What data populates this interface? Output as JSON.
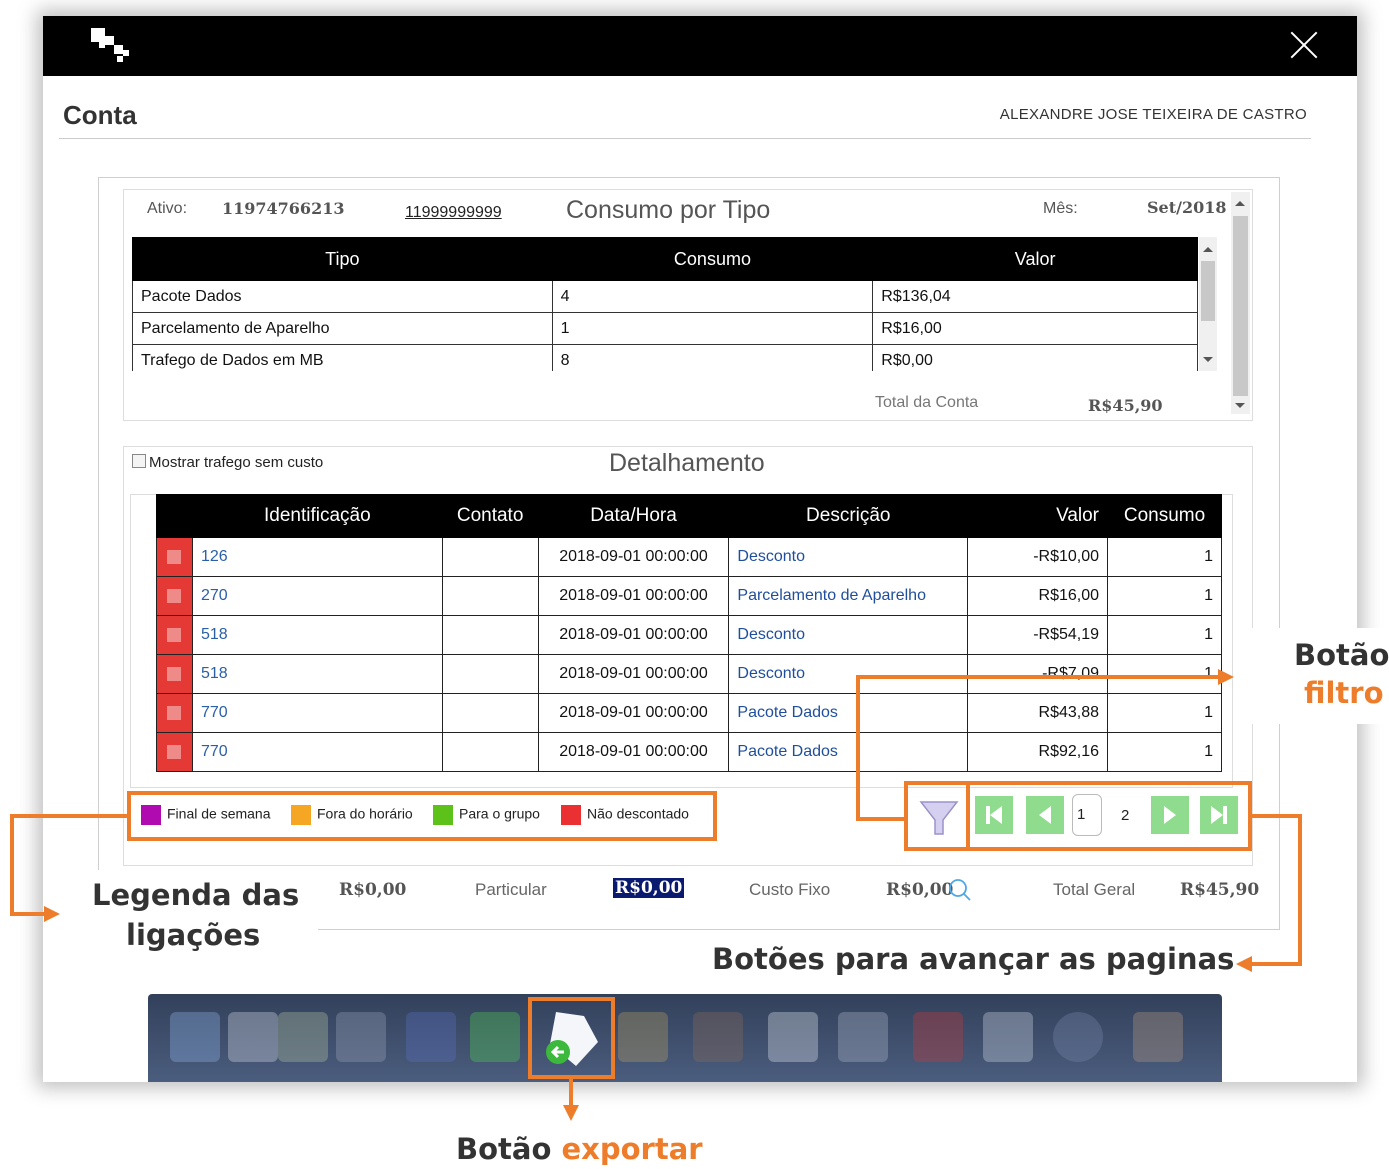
{
  "window": {
    "page_title": "Conta",
    "user_name": "ALEXANDRE JOSE TEIXEIRA DE CASTRO"
  },
  "summary": {
    "ativo_label": "Ativo:",
    "ativo_value": "11974766213",
    "phone_link": "11999999999",
    "heading": "Consumo por Tipo",
    "mes_label": "Mês:",
    "mes_value": "Set/2018",
    "total_label": "Total da Conta",
    "total_value": "R$45,90",
    "columns": [
      "Tipo",
      "Consumo",
      "Valor"
    ],
    "rows": [
      [
        "Pacote Dados",
        "4",
        "R$136,04"
      ],
      [
        "Parcelamento de Aparelho",
        "1",
        "R$16,00"
      ],
      [
        "Trafego de Dados em MB",
        "8",
        "R$0,00"
      ]
    ]
  },
  "detail": {
    "checkbox_label": "Mostrar trafego sem custo",
    "heading": "Detalhamento",
    "columns": [
      "Identificação",
      "Contato",
      "Data/Hora",
      "Descrição",
      "Valor",
      "Consumo"
    ],
    "rows": [
      [
        "126",
        "",
        "2018-09-01 00:00:00",
        "Desconto",
        "-R$10,00",
        "1"
      ],
      [
        "270",
        "",
        "2018-09-01 00:00:00",
        "Parcelamento de Aparelho",
        "R$16,00",
        "1"
      ],
      [
        "518",
        "",
        "2018-09-01 00:00:00",
        "Desconto",
        "-R$54,19",
        "1"
      ],
      [
        "518",
        "",
        "2018-09-01 00:00:00",
        "Desconto",
        "-R$7,09",
        "1"
      ],
      [
        "770",
        "",
        "2018-09-01 00:00:00",
        "Pacote Dados",
        "R$43,88",
        "1"
      ],
      [
        "770",
        "",
        "2018-09-01 00:00:00",
        "Pacote Dados",
        "R$92,16",
        "1"
      ]
    ]
  },
  "legend": [
    {
      "label": "Final de semana",
      "color": "#b00bb0"
    },
    {
      "label": "Fora do horário",
      "color": "#f5a623"
    },
    {
      "label": "Para o grupo",
      "color": "#5cc21a"
    },
    {
      "label": "Não descontado",
      "color": "#ea3030"
    }
  ],
  "pager": {
    "current_page_value": "1",
    "page_2": "2"
  },
  "totals": {
    "first_value": "R$0,00",
    "particular_label": "Particular",
    "particular_value": "R$0,00",
    "custo_fixo_label": "Custo Fixo",
    "custo_fixo_value": "R$0,00",
    "total_geral_label": "Total Geral",
    "total_geral_value": "R$45,90"
  },
  "annotations": {
    "filtro_line1": "Botão",
    "filtro_line2": "filtro",
    "legenda_line1": "Legenda das",
    "legenda_line2": "ligações",
    "paginas": "Botões para avançar as paginas",
    "exportar_prefix": "Botão",
    "exportar_highlight": "exportar"
  },
  "colors": {
    "accent_orange": "#ee7d2b",
    "pager_green": "#8fdc8f",
    "row_marker_red": "#e53935",
    "link_blue": "#2b60a8"
  },
  "icons": {
    "filter": "funnel-icon",
    "pager_first": "first-page-icon",
    "pager_prev": "prev-page-icon",
    "pager_next": "next-page-icon",
    "pager_last": "last-page-icon",
    "export": "export-document-icon",
    "search": "search-icon",
    "close": "close-icon"
  }
}
